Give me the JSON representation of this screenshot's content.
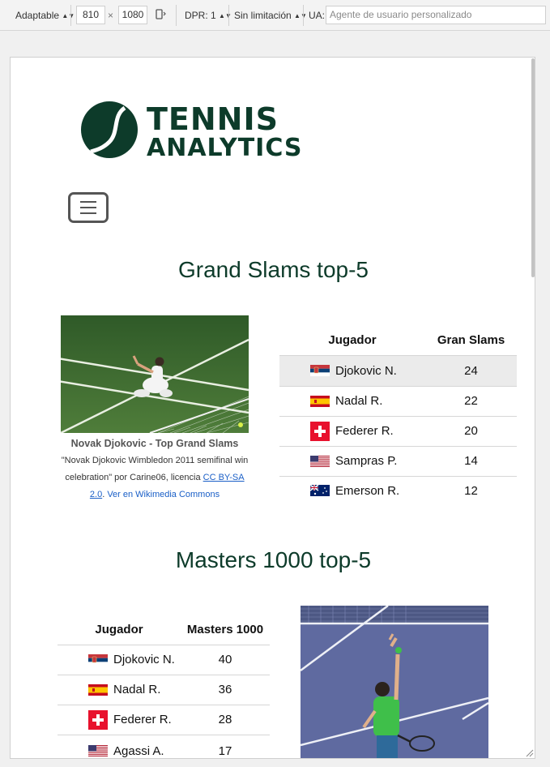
{
  "toolbar": {
    "mode": "Adaptable",
    "width": "810",
    "times": "×",
    "height": "1080",
    "dpr": "DPR: 1",
    "throttle": "Sin limitación",
    "ua_label": "UA:",
    "ua_placeholder": "Agente de usuario personalizado"
  },
  "logo": {
    "line1": "TENNIS",
    "line2": "ANALYTICS"
  },
  "grand_slams": {
    "title": "Grand Slams top-5",
    "headers": [
      "Jugador",
      "Gran Slams"
    ],
    "rows": [
      {
        "player": "Djokovic N.",
        "value": "24",
        "flag": "serbia"
      },
      {
        "player": "Nadal R.",
        "value": "22",
        "flag": "spain"
      },
      {
        "player": "Federer R.",
        "value": "20",
        "flag": "switzerland"
      },
      {
        "player": "Sampras P.",
        "value": "14",
        "flag": "usa"
      },
      {
        "player": "Emerson R.",
        "value": "12",
        "flag": "australia"
      }
    ],
    "caption": {
      "title": "Novak Djokovic - Top Grand Slams",
      "text": "\"Novak Djokovic Wimbledon 2011 semifinal win celebration\" por Carine06, licencia ",
      "license": "CC BY-SA 2.0",
      "link": "Ver en Wikimedia Commons"
    }
  },
  "masters": {
    "title": "Masters 1000 top-5",
    "headers": [
      "Jugador",
      "Masters 1000"
    ],
    "rows": [
      {
        "player": "Djokovic N.",
        "value": "40",
        "flag": "serbia"
      },
      {
        "player": "Nadal R.",
        "value": "36",
        "flag": "spain"
      },
      {
        "player": "Federer R.",
        "value": "28",
        "flag": "switzerland"
      },
      {
        "player": "Agassi A.",
        "value": "17",
        "flag": "usa"
      }
    ]
  },
  "colors": {
    "brand": "#0d3b2a",
    "link": "#1a5fc7"
  }
}
